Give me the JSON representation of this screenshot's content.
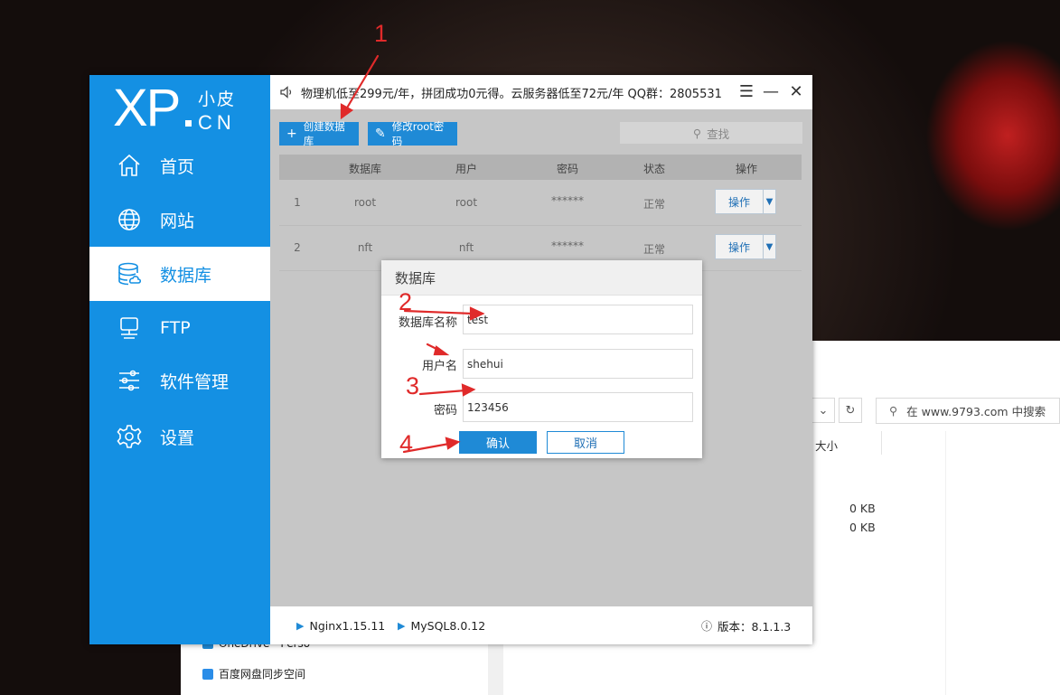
{
  "explorer": {
    "search_placeholder": "在 www.9793.com 中搜索",
    "column_size": "大小",
    "sizes": [
      "0 KB",
      "0 KB"
    ],
    "sidebar_items": [
      "OneDrive - Perso",
      "百度网盘同步空间"
    ],
    "refresh_icon": "refresh-icon",
    "dropdown_icon": "chevron-down-icon"
  },
  "app": {
    "logo": {
      "xp": "XP",
      "cn_top": "小皮",
      "cn_bottom": "CN"
    },
    "nav": [
      {
        "label": "首页",
        "icon": "home-icon"
      },
      {
        "label": "网站",
        "icon": "globe-icon"
      },
      {
        "label": "数据库",
        "icon": "database-icon",
        "active": true
      },
      {
        "label": "FTP",
        "icon": "server-icon"
      },
      {
        "label": "软件管理",
        "icon": "sliders-icon"
      },
      {
        "label": "设置",
        "icon": "gear-icon"
      }
    ],
    "marquee": "物理机低至299元/年，拼团成功0元得。云服务器低至72元/年 QQ群：2805531",
    "window_controls": {
      "menu": "☰",
      "minimize": "—",
      "close": "✕"
    },
    "toolbar": {
      "create_db": "创建数据库",
      "change_root_pwd": "修改root密码",
      "search_placeholder": "查找"
    },
    "table": {
      "headers": [
        "数据库",
        "用户",
        "密码",
        "状态",
        "操作"
      ],
      "rows": [
        {
          "index": "1",
          "database": "root",
          "user": "root",
          "password": "******",
          "status": "正常",
          "action": "操作"
        },
        {
          "index": "2",
          "database": "nft",
          "user": "nft",
          "password": "******",
          "status": "正常",
          "action": "操作"
        }
      ]
    },
    "status": {
      "nginx": "Nginx1.15.11",
      "mysql": "MySQL8.0.12",
      "version_label": "版本：8.1.1.3"
    }
  },
  "dialog": {
    "title": "数据库",
    "db_name_label": "数据库名称",
    "db_name_value": "test",
    "username_label": "用户名",
    "username_value": "shehui",
    "password_label": "密码",
    "password_value": "123456",
    "ok": "确认",
    "cancel": "取消"
  },
  "annotations": [
    "1",
    "2",
    "3",
    "4"
  ],
  "colors": {
    "accent": "#1490e3",
    "button": "#1f8ad6",
    "annotation": "#e02a2a"
  }
}
